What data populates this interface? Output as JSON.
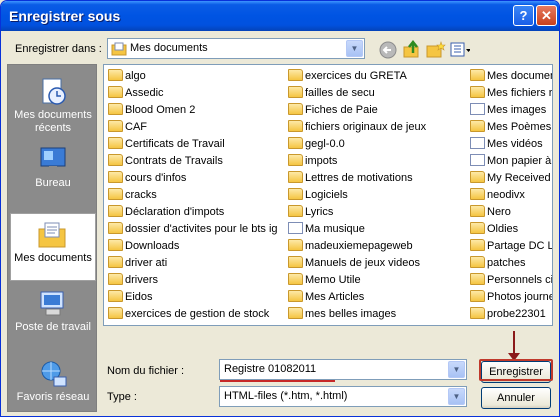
{
  "window": {
    "title": "Enregistrer sous",
    "help_glyph": "?",
    "close_glyph": "✕"
  },
  "toolbar": {
    "save_in_label": "Enregistrer dans :",
    "location": "Mes documents",
    "icons": [
      "back-icon",
      "up-folder-icon",
      "new-folder-icon",
      "view-menu-icon"
    ]
  },
  "places": [
    {
      "label": "Mes documents récents",
      "icon": "recent-documents-icon",
      "selected": false
    },
    {
      "label": "Bureau",
      "icon": "desktop-icon",
      "selected": false
    },
    {
      "label": "Mes documents",
      "icon": "my-documents-icon",
      "selected": true
    },
    {
      "label": "Poste de travail",
      "icon": "my-computer-icon",
      "selected": false
    },
    {
      "label": "Favoris réseau",
      "icon": "network-places-icon",
      "selected": false
    }
  ],
  "files": {
    "col1": [
      "algo",
      "Assedic",
      "Blood Omen 2",
      "CAF",
      "Certificats de Travail",
      "Contrats de Travails",
      "cours d'infos",
      "cracks",
      "Déclaration d'impots",
      "dossier d'activites pour le bts ig",
      "Downloads",
      "driver ati",
      "drivers",
      "Eidos",
      "exercices de gestion de stock"
    ],
    "col2": [
      "exercices du GRETA",
      "failles de secu",
      "Fiches de Paie",
      "fichiers originaux de jeux",
      "gegl-0.0",
      "impots",
      "Lettres de motivations",
      "Logiciels",
      "Lyrics",
      "Ma musique",
      "madeuxiemepageweb",
      "Manuels de jeux videos",
      "Memo Utile",
      "Mes Articles",
      "mes belles images"
    ],
    "col3": [
      "Mes documents",
      "Mes fichiers re",
      "Mes images",
      "Mes Poèmes",
      "Mes vidéos",
      "Mon papier à l",
      "My Received F",
      "neodivx",
      "Nero",
      "Oldies",
      "Partage DC LA",
      "patches",
      "Personnels civ",
      "Photos journe",
      "probe22301"
    ],
    "col2_special": {
      "Ma musique": "doc",
      "Mes images": "doc",
      "Mes vidéos": "doc",
      "Mon papier à l": "doc"
    }
  },
  "form": {
    "filename_label": "Nom du fichier :",
    "filename_value": "Registre 01082011",
    "type_label": "Type :",
    "type_value": "HTML-files (*.htm, *.html)",
    "save_button": "Enregistrer",
    "cancel_button": "Annuler"
  }
}
